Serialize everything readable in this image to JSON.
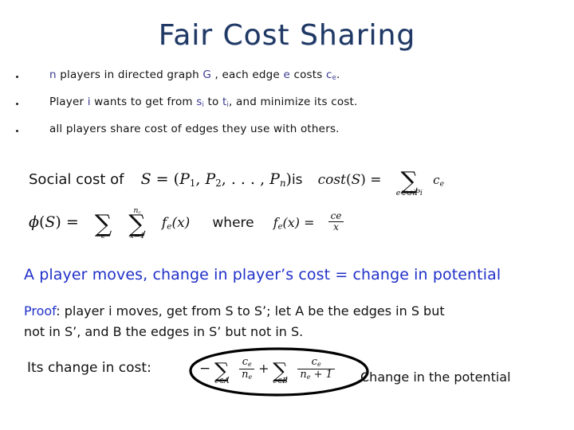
{
  "slide": {
    "title": "Fair Cost Sharing",
    "title_color": "#1f3864",
    "accent_blue": "#2030c8",
    "math_blue": "#3b3b8f"
  },
  "bullets": [
    {
      "marker": "•",
      "segments": [
        {
          "text": "n",
          "style": "math"
        },
        {
          "text": " players in directed graph ",
          "style": "plain"
        },
        {
          "text": "G",
          "style": "math"
        },
        {
          "text": " , each edge ",
          "style": "plain"
        },
        {
          "text": "e",
          "style": "math"
        },
        {
          "text": " costs ",
          "style": "plain"
        },
        {
          "text": "ce",
          "style": "math-sub"
        },
        {
          "text": ".",
          "style": "plain"
        }
      ],
      "plain_text": "n players in directed graph G , each edge e costs ce."
    },
    {
      "marker": "•",
      "segments": [
        {
          "text": "Player ",
          "style": "plain"
        },
        {
          "text": "i",
          "style": "math"
        },
        {
          "text": " wants to get from ",
          "style": "plain"
        },
        {
          "text": "si",
          "style": "math-sub"
        },
        {
          "text": " to ",
          "style": "plain"
        },
        {
          "text": "ti",
          "style": "math-sub"
        },
        {
          "text": ", and minimize its cost.",
          "style": "plain"
        }
      ],
      "plain_text": "Player i wants to get from si to ti, and minimize its cost."
    },
    {
      "marker": "•",
      "segments": [
        {
          "text": "all players share cost of edges they use with others.",
          "style": "plain"
        }
      ],
      "plain_text": "all players share cost of edges they use with others."
    }
  ],
  "formula_block": {
    "lead_label": "Social cost of",
    "strategy_profile": "S = (P1, P2, . . . , Pn)",
    "is_word": "is",
    "cost_def_lhs": "cost(S) =",
    "cost_sum_var": "ce",
    "cost_sum_limit": "e∈∪iPi",
    "phi_lhs": "φ(S) =",
    "phi_sum1_limit": "e",
    "phi_sum2_lower": "x=1",
    "phi_sum2_upper": "nc",
    "phi_term": "fe(x)",
    "where_word": "where",
    "fe_lhs": "fe(x) =",
    "fe_num": "ce",
    "fe_den": "x"
  },
  "statement": {
    "text": "A player moves, change in player’s cost = change in potential"
  },
  "proof": {
    "keyword": "Proof",
    "line1": ": player i moves, get from S to S’;  let A be the edges in S but",
    "line2": "not in S’, and B the edges in S’ but not in S."
  },
  "bottom": {
    "cost_label": "Its change in cost:",
    "minus_sign": "−",
    "sumA_limit": "e∈A",
    "termA_num": "ce",
    "termA_den": "ne",
    "plus_sign": "+",
    "sumB_limit": "e∈B",
    "termB_num": "ce",
    "termB_den": "ne + 1",
    "annotation": "Change in the potential",
    "ellipse_color": "#000000"
  }
}
